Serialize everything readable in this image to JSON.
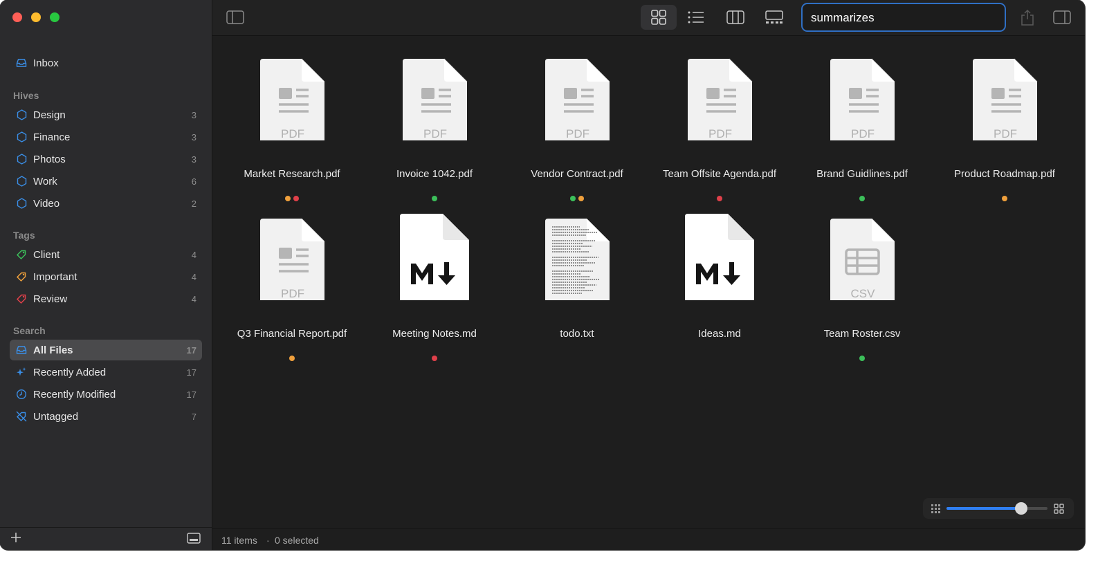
{
  "sidebar": {
    "inbox": "Inbox",
    "hives_header": "Hives",
    "hives": [
      {
        "label": "Design",
        "count": "3"
      },
      {
        "label": "Finance",
        "count": "3"
      },
      {
        "label": "Photos",
        "count": "3"
      },
      {
        "label": "Work",
        "count": "6"
      },
      {
        "label": "Video",
        "count": "2"
      }
    ],
    "tags_header": "Tags",
    "tags": [
      {
        "label": "Client",
        "count": "4",
        "color": "#3cbf5a"
      },
      {
        "label": "Important",
        "count": "4",
        "color": "#f0a03c"
      },
      {
        "label": "Review",
        "count": "4",
        "color": "#e0404a"
      }
    ],
    "search_header": "Search",
    "searches": [
      {
        "label": "All Files",
        "count": "17",
        "icon": "tray-icon"
      },
      {
        "label": "Recently Added",
        "count": "17",
        "icon": "sparkle-icon"
      },
      {
        "label": "Recently Modified",
        "count": "17",
        "icon": "clock-icon"
      },
      {
        "label": "Untagged",
        "count": "7",
        "icon": "untag-icon"
      }
    ]
  },
  "toolbar": {
    "search_value": "summarizes"
  },
  "files": [
    {
      "name": "Market Research.pdf",
      "type": "PDF",
      "tags": [
        "#f0a03c",
        "#e0404a"
      ]
    },
    {
      "name": "Invoice 1042.pdf",
      "type": "PDF",
      "tags": [
        "#3cbf5a"
      ]
    },
    {
      "name": "Vendor Contract.pdf",
      "type": "PDF",
      "tags": [
        "#3cbf5a",
        "#f0a03c"
      ]
    },
    {
      "name": "Team Offsite Agenda.pdf",
      "type": "PDF",
      "tags": [
        "#e0404a"
      ]
    },
    {
      "name": "Brand Guidlines.pdf",
      "type": "PDF",
      "tags": [
        "#3cbf5a"
      ]
    },
    {
      "name": "Product Roadmap.pdf",
      "type": "PDF",
      "tags": [
        "#f0a03c"
      ]
    },
    {
      "name": "Q3 Financial Report.pdf",
      "type": "PDF",
      "tags": [
        "#f0a03c"
      ]
    },
    {
      "name": "Meeting Notes.md",
      "type": "MD",
      "tags": [
        "#e0404a"
      ]
    },
    {
      "name": "todo.txt",
      "type": "TXT",
      "tags": []
    },
    {
      "name": "Ideas.md",
      "type": "MD",
      "tags": []
    },
    {
      "name": "Team Roster.csv",
      "type": "CSV",
      "tags": [
        "#3cbf5a"
      ]
    }
  ],
  "status": {
    "items": "11 items",
    "separator": "·",
    "selected": "0 selected"
  },
  "zoom": {
    "level": 0.74
  }
}
